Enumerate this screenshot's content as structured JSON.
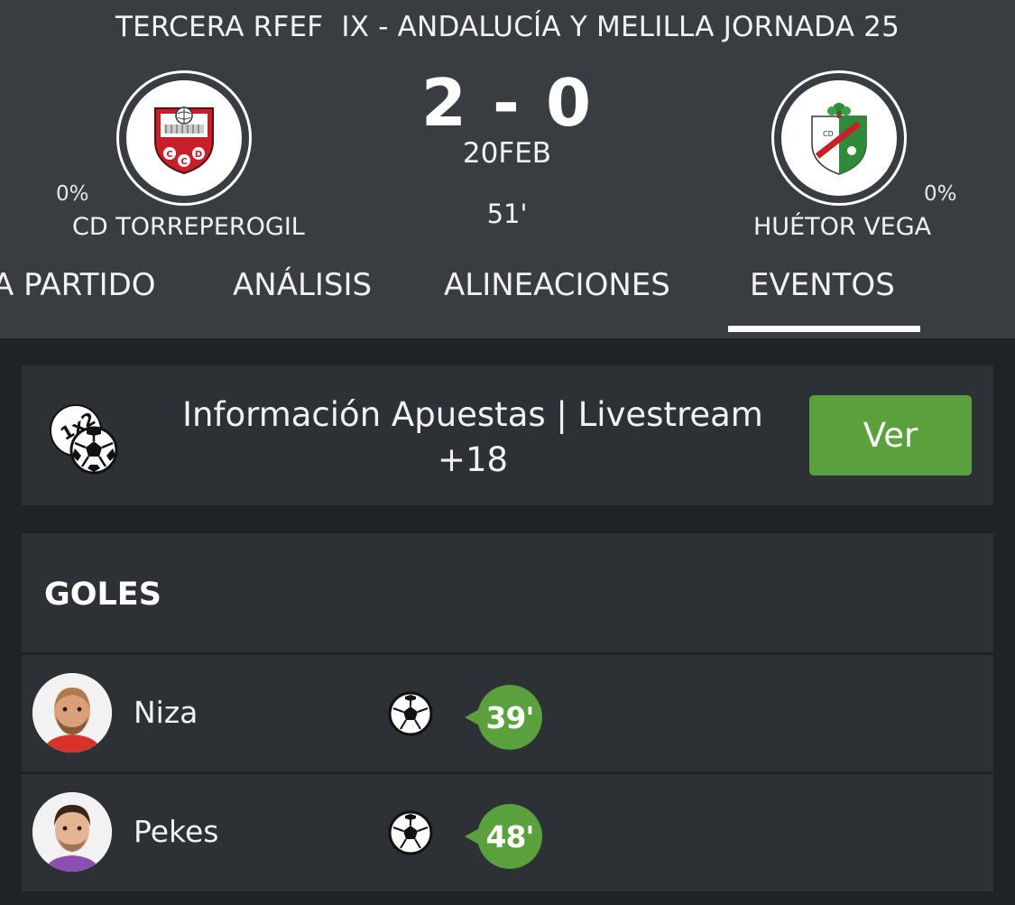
{
  "match": {
    "competition": "TERCERA RFEF  IX - ANDALUCÍA Y MELILLA JORNADA 25",
    "score": "2 - 0",
    "date": "20FEB",
    "minute": "51'",
    "home": {
      "name": "CD TORREPEROGIL",
      "pct": "0%",
      "logo_icon": "cd-torreperogil-crest-icon"
    },
    "away": {
      "name": "HUÉTOR VEGA",
      "pct": "0%",
      "logo_icon": "cd-huetor-vega-crest-icon"
    }
  },
  "tabs": [
    {
      "label": "A PARTIDO",
      "active": false
    },
    {
      "label": "ANÁLISIS",
      "active": false
    },
    {
      "label": "ALINEACIONES",
      "active": false
    },
    {
      "label": "EVENTOS",
      "active": true
    }
  ],
  "betting": {
    "text": "Información Apuestas | Livestream +18",
    "button_label": "Ver",
    "icon": "1x2-ball-icon",
    "accent": "#5aa03c"
  },
  "goals": {
    "title": "GOLES",
    "rows": [
      {
        "player": "Niza",
        "minute": "39'",
        "icon": "soccer-ball-icon"
      },
      {
        "player": "Pekes",
        "minute": "48'",
        "icon": "soccer-ball-icon"
      }
    ]
  },
  "colors": {
    "header_bg": "#393d42",
    "page_bg": "#202326",
    "card_bg": "#2d3135",
    "accent_green": "#5aa03c"
  }
}
